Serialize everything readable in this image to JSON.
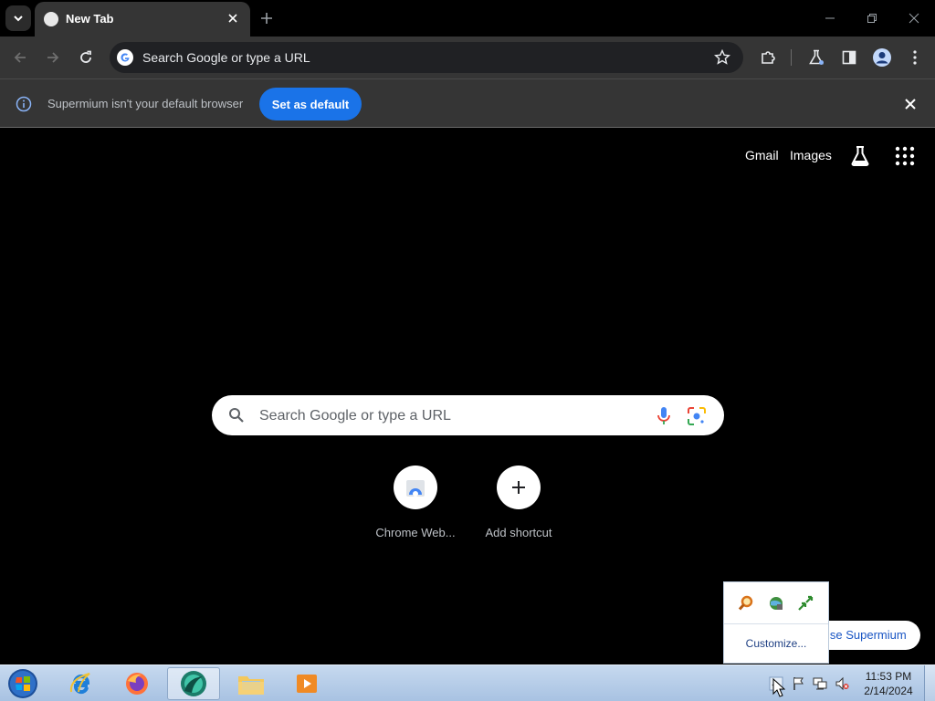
{
  "tab": {
    "title": "New Tab"
  },
  "omnibox": {
    "text": "Search Google or type a URL"
  },
  "infobar": {
    "message": "Supermium isn't your default browser",
    "button": "Set as default"
  },
  "ntp": {
    "links": {
      "gmail": "Gmail",
      "images": "Images"
    },
    "search_placeholder": "Search Google or type a URL",
    "shortcuts": [
      {
        "label": "Chrome Web..."
      },
      {
        "label": "Add shortcut"
      }
    ],
    "customise_label": "ise Supermium"
  },
  "tray_popup": {
    "customize": "Customize..."
  },
  "clock": {
    "time": "11:53 PM",
    "date": "2/14/2024"
  },
  "colors": {
    "accent": "#1a73e8",
    "toolbar": "#353535",
    "background": "#000000"
  }
}
